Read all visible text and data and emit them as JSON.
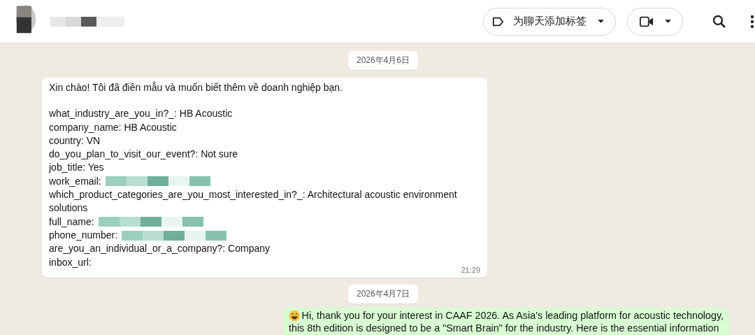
{
  "header": {
    "label_button": "为聊天添加标签"
  },
  "messages": [
    {
      "kind": "date",
      "text": "2026年4月6日"
    },
    {
      "kind": "incoming",
      "intro": "Xin chào! Tôi đã điền mẫu và muốn biết thêm về doanh nghiệp bạn.",
      "fields": [
        {
          "text": "what_industry_are_you_in?_: HB Acoustic",
          "redacted": false
        },
        {
          "text": "company_name: HB Acoustic",
          "redacted": false
        },
        {
          "text": "country: VN",
          "redacted": false
        },
        {
          "text": "do_you_plan_to_visit_our_event?: Not sure",
          "redacted": false
        },
        {
          "text": "job_title: Yes",
          "redacted": false
        },
        {
          "text": "work_email:",
          "redacted": true
        },
        {
          "text": "which_product_categories_are_you_most_interested_in?_: Architectural acoustic environment",
          "redacted": false
        },
        {
          "text": "solutions",
          "redacted": false
        },
        {
          "text": "full_name:",
          "redacted": true
        },
        {
          "text": "phone_number:",
          "redacted": true
        },
        {
          "text": "are_you_an_individual_or_a_company?: Company",
          "redacted": false
        },
        {
          "text": "inbox_url:",
          "redacted": false
        }
      ],
      "time": "21:29"
    },
    {
      "kind": "date",
      "text": "2026年4月7日"
    },
    {
      "kind": "outgoing",
      "lines": [
        "Hi, thank you for your interest in CAAF 2026. As Asia’s leading platform for acoustic technology,",
        "this 8th edition is designed to be a \"Smart Brain\" for the industry. Here is the essential information"
      ]
    }
  ]
}
